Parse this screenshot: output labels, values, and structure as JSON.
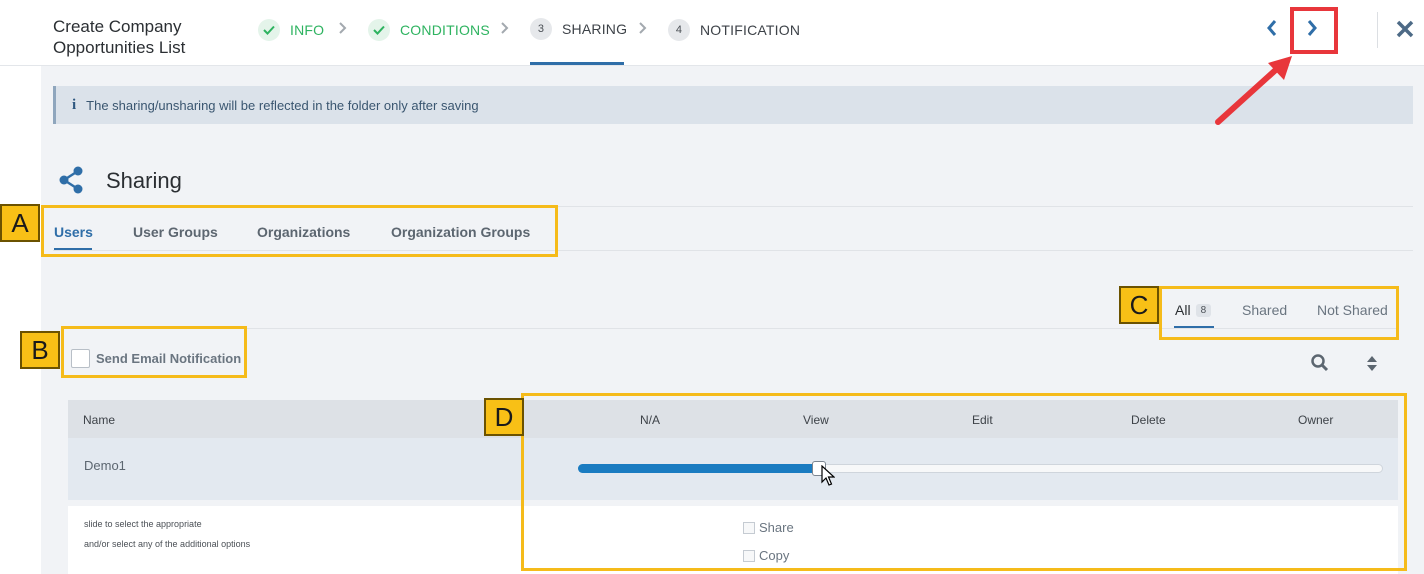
{
  "header": {
    "title": "Create Company Opportunities List",
    "steps": [
      {
        "number": "",
        "label": "INFO",
        "state": "done"
      },
      {
        "number": "",
        "label": "CONDITIONS",
        "state": "done"
      },
      {
        "number": "3",
        "label": "SHARING",
        "state": "active"
      },
      {
        "number": "4",
        "label": "NOTIFICATION",
        "state": "todo"
      }
    ],
    "prev_icon": "chevron-left-icon",
    "next_icon": "chevron-right-icon",
    "close_icon": "close-icon"
  },
  "info_bar": {
    "icon": "i",
    "message": "The sharing/unsharing will be reflected in the folder only after saving"
  },
  "section": {
    "title": "Sharing"
  },
  "tabs": [
    {
      "label": "Users",
      "active": true
    },
    {
      "label": "User Groups",
      "active": false
    },
    {
      "label": "Organizations",
      "active": false
    },
    {
      "label": "Organization Groups",
      "active": false
    }
  ],
  "filters": {
    "all_label": "All",
    "all_count": "8",
    "shared_label": "Shared",
    "not_shared_label": "Not Shared"
  },
  "email_notification": {
    "label": "Send Email Notification",
    "checked": false
  },
  "table": {
    "columns": [
      "Name",
      "N/A",
      "View",
      "Edit",
      "Delete",
      "Owner"
    ],
    "row": {
      "name": "Demo1",
      "permission_level": "View",
      "slider_fraction": 0.3
    },
    "hint_line1": "slide to select the appropriate",
    "hint_line2": "and/or select any of the additional options",
    "options": [
      {
        "label": "Share",
        "checked": false
      },
      {
        "label": "Copy",
        "checked": false
      }
    ]
  },
  "annotations": {
    "a": "A",
    "b": "B",
    "c": "C",
    "d": "D"
  },
  "colors": {
    "accent": "#2f6ea8",
    "done_green": "#2eb360",
    "slider_fill": "#1a7cc1",
    "annotation_yellow": "#f5bb1a",
    "annotation_red": "#e8363b"
  }
}
